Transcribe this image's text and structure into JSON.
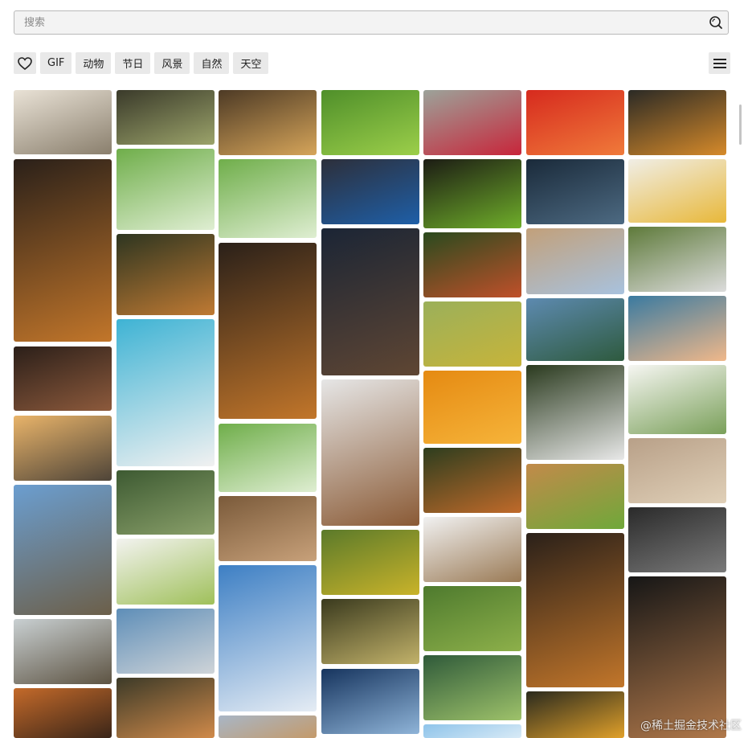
{
  "search": {
    "placeholder": "搜索",
    "value": ""
  },
  "toolbar": {
    "favorites_icon": "heart-icon",
    "tags": [
      "GIF",
      "动物",
      "节日",
      "风景",
      "自然",
      "天空"
    ],
    "menu_icon": "hamburger-menu-icon"
  },
  "watermark": "@稀土掘金技术社区",
  "gallery": {
    "columns": [
      [
        {
          "subject": "winding-road-with-trees",
          "colors": [
            "#e9e2d6",
            "#8a7f6d"
          ]
        },
        {
          "subject": "autumn-forest-road-aerial",
          "colors": [
            "#2a2019",
            "#c2762a"
          ]
        },
        {
          "subject": "bar-shelves-bottles",
          "colors": [
            "#2b1f19",
            "#8d5a3c"
          ]
        },
        {
          "subject": "car-on-desert-road",
          "colors": [
            "#e9b46a",
            "#4e4438"
          ]
        },
        {
          "subject": "trail-sign-mountains",
          "colors": [
            "#6b9ed0",
            "#6c5f49"
          ]
        },
        {
          "subject": "foggy-valley-landscape",
          "colors": [
            "#c9d0d2",
            "#5d5342"
          ]
        },
        {
          "subject": "sunset-clouds",
          "colors": [
            "#c46a2a",
            "#3a2518"
          ]
        }
      ],
      [
        {
          "subject": "car-interior-dashboard",
          "colors": [
            "#3a3a2a",
            "#9ba36a"
          ]
        },
        {
          "subject": "owl-on-branch",
          "colors": [
            "#6fae4a",
            "#dfeed2"
          ]
        },
        {
          "subject": "tiger-swimming",
          "colors": [
            "#2d3520",
            "#c07a33"
          ]
        },
        {
          "subject": "child-in-pool-with-floats",
          "colors": [
            "#3eb3d4",
            "#f1f1f1"
          ]
        },
        {
          "subject": "kingfisher-bird",
          "colors": [
            "#3d5a32",
            "#8aa06a"
          ]
        },
        {
          "subject": "cutting-fruit",
          "colors": [
            "#f3f3f0",
            "#9fc05a"
          ]
        },
        {
          "subject": "curved-road-overlook",
          "colors": [
            "#5e8eb8",
            "#cfd4d8"
          ]
        },
        {
          "subject": "mushrooms-forest",
          "colors": [
            "#3c3a28",
            "#d08a4a"
          ]
        }
      ],
      [
        {
          "subject": "heart-shaped-road-aerial",
          "colors": [
            "#4d3a25",
            "#d6a55a"
          ]
        },
        {
          "subject": "owl-on-branch",
          "colors": [
            "#6fae4a",
            "#dfeed2"
          ]
        },
        {
          "subject": "autumn-forest-road-aerial",
          "colors": [
            "#2a2019",
            "#c2762a"
          ]
        },
        {
          "subject": "owl-on-branch",
          "colors": [
            "#6fae4a",
            "#dfeed2"
          ]
        },
        {
          "subject": "animal-fur-closeup",
          "colors": [
            "#7a5a3a",
            "#c8a17a"
          ]
        },
        {
          "subject": "sky-above-clouds",
          "colors": [
            "#3d7fc4",
            "#e5ecf4"
          ]
        },
        {
          "subject": "desert-horizon",
          "colors": [
            "#a8b6c6",
            "#c49a6a"
          ]
        }
      ],
      [
        {
          "subject": "rice-terraces",
          "colors": [
            "#4f8f2a",
            "#9ccf4a"
          ]
        },
        {
          "subject": "peacock",
          "colors": [
            "#2d2f3a",
            "#1e5fa8"
          ]
        },
        {
          "subject": "canyon-silhouette-night",
          "colors": [
            "#1b2535",
            "#5f4633"
          ]
        },
        {
          "subject": "horse-in-snow",
          "colors": [
            "#e6e6e6",
            "#8a5a35"
          ]
        },
        {
          "subject": "autumn-forest-path",
          "colors": [
            "#5b7a2a",
            "#c9b32a"
          ]
        },
        {
          "subject": "yellow-bird-on-branch",
          "colors": [
            "#3a3a1e",
            "#c2b26a"
          ]
        },
        {
          "subject": "winding-river-aerial",
          "colors": [
            "#16345e",
            "#8fb4d8"
          ]
        }
      ],
      [
        {
          "subject": "red-leaf",
          "colors": [
            "#9ca39a",
            "#c8253a"
          ]
        },
        {
          "subject": "green-parrot",
          "colors": [
            "#1c1c14",
            "#6fae2a"
          ]
        },
        {
          "subject": "red-panda-in-tree",
          "colors": [
            "#2a4a1e",
            "#c0502a"
          ]
        },
        {
          "subject": "small-bird-on-plant",
          "colors": [
            "#9bb05a",
            "#c7b43a"
          ]
        },
        {
          "subject": "oranges-pile",
          "colors": [
            "#e58a12",
            "#f6b43a"
          ]
        },
        {
          "subject": "rooster",
          "colors": [
            "#2d3d1e",
            "#c06a2a"
          ]
        },
        {
          "subject": "duck-standing",
          "colors": [
            "#f1f1f1",
            "#9a7a55"
          ]
        },
        {
          "subject": "butterfly-green-background",
          "colors": [
            "#4e7a2e",
            "#8db04a"
          ]
        },
        {
          "subject": "cactus-plants",
          "colors": [
            "#2f5a3a",
            "#9ec26a"
          ]
        },
        {
          "subject": "sky-blue",
          "colors": [
            "#8fc4ea",
            "#d8eaf6"
          ]
        }
      ],
      [
        {
          "subject": "red-dahlia-flower",
          "colors": [
            "#d62a1e",
            "#f07a3a"
          ]
        },
        {
          "subject": "dark-water-texture",
          "colors": [
            "#1a2a3a",
            "#4d6a82"
          ]
        },
        {
          "subject": "car-in-desert-canyon",
          "colors": [
            "#c2a07a",
            "#a8c2de"
          ]
        },
        {
          "subject": "lake-mountain-reflection",
          "colors": [
            "#5d8ab0",
            "#2e5a3e"
          ]
        },
        {
          "subject": "panda-eating-bamboo",
          "colors": [
            "#2a3a1e",
            "#e8e8e8"
          ]
        },
        {
          "subject": "giraffe-closeup",
          "colors": [
            "#c28a4a",
            "#6fa83a"
          ]
        },
        {
          "subject": "autumn-forest-road-aerial",
          "colors": [
            "#2a2019",
            "#c2762a"
          ]
        },
        {
          "subject": "butterfly-on-flowers",
          "colors": [
            "#2a2a1e",
            "#e0a02a"
          ]
        }
      ],
      [
        {
          "subject": "golden-mountain-peaks",
          "colors": [
            "#2b2a25",
            "#d68a2a"
          ]
        },
        {
          "subject": "yellow-rose-with-book",
          "colors": [
            "#f0eee6",
            "#e8b83a"
          ]
        },
        {
          "subject": "waterfall-rocks",
          "colors": [
            "#5e7a3a",
            "#dcdcdc"
          ]
        },
        {
          "subject": "valley-river-sunset",
          "colors": [
            "#3a7aa0",
            "#f0b88a"
          ]
        },
        {
          "subject": "minimal-art-drawing",
          "colors": [
            "#f6f6f2",
            "#7aa05a"
          ]
        },
        {
          "subject": "red-canyon-beach",
          "colors": [
            "#b8a088",
            "#e0d0b8"
          ]
        },
        {
          "subject": "graffiti-tunnel",
          "colors": [
            "#2a2a2a",
            "#7a7a7a"
          ]
        },
        {
          "subject": "latte-art-pour",
          "colors": [
            "#161616",
            "#b0784a"
          ]
        }
      ]
    ]
  }
}
